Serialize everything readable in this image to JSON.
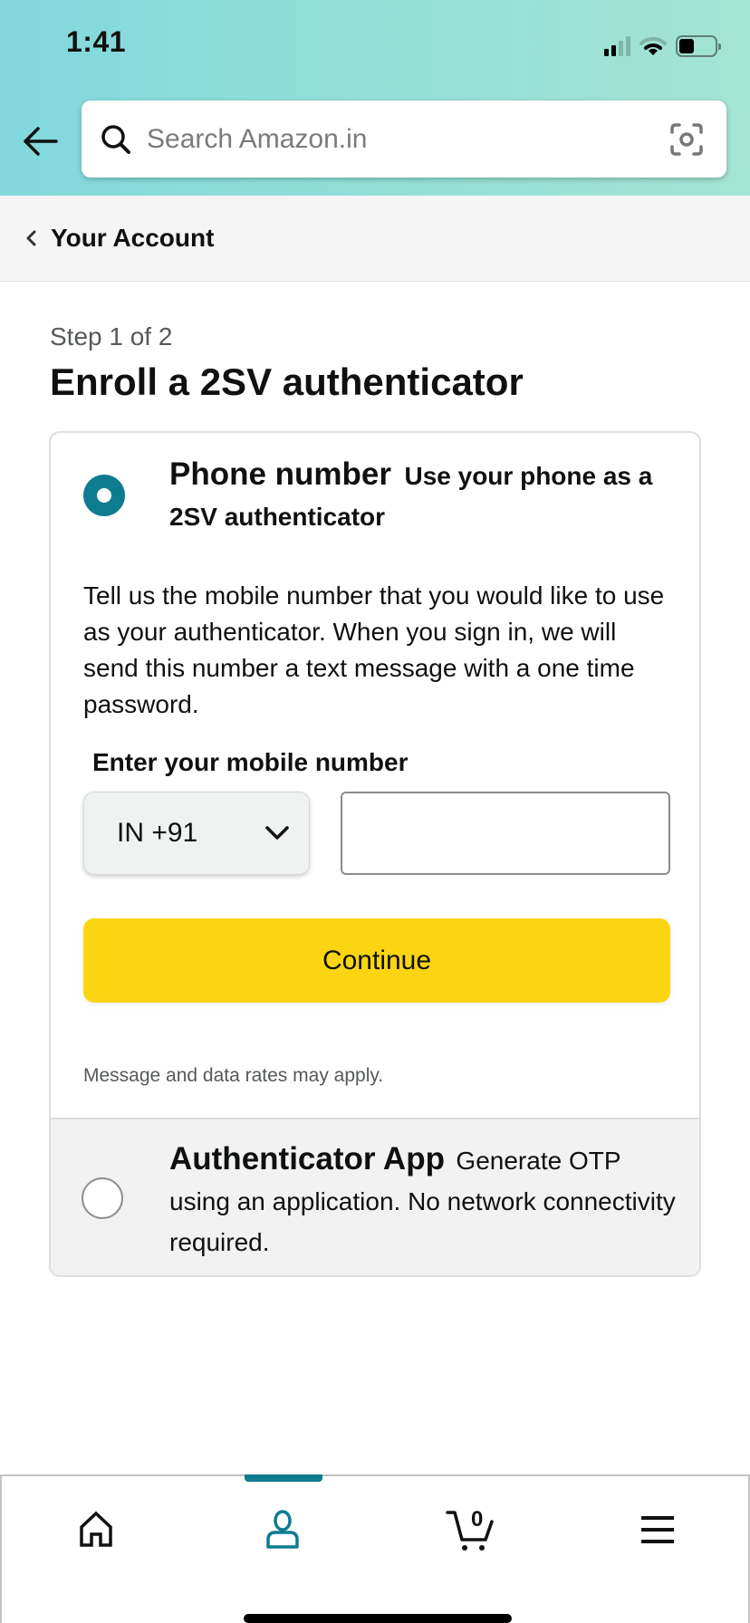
{
  "status_bar": {
    "time": "1:41",
    "signal_icon": "cellular-signal-icon",
    "wifi_icon": "wifi-icon",
    "battery_icon": "battery-icon"
  },
  "header": {
    "back_icon": "arrow-left-icon",
    "search": {
      "placeholder": "Search Amazon.in",
      "value": "",
      "search_icon": "search-icon",
      "camera_icon": "camera-scan-icon"
    }
  },
  "breadcrumb": {
    "label": "Your Account",
    "icon": "chevron-left-icon"
  },
  "main": {
    "step": "Step 1 of 2",
    "title": "Enroll a 2SV authenticator",
    "options": [
      {
        "title": "Phone number",
        "subtitle": "Use your phone as a 2SV authenticator",
        "selected": true,
        "description": "Tell us the mobile number that you would like to use as your authenticator. When you sign in, we will send this number a text message with a one time password.",
        "field_label": "Enter your mobile number",
        "country_code": "IN +91",
        "phone_value": "",
        "continue_label": "Continue",
        "note": "Message and data rates may apply."
      },
      {
        "title": "Authenticator App",
        "subtitle": "Generate OTP using an application. No network connectivity required.",
        "selected": false
      }
    ]
  },
  "bottom_nav": {
    "items": [
      {
        "name": "home",
        "icon": "home-icon",
        "active": false
      },
      {
        "name": "account",
        "icon": "user-icon",
        "active": true
      },
      {
        "name": "cart",
        "icon": "cart-icon",
        "active": false,
        "count": "0"
      },
      {
        "name": "menu",
        "icon": "hamburger-menu-icon",
        "active": false
      }
    ]
  },
  "colors": {
    "accent": "#0e7c8f",
    "button_yellow": "#fcd512",
    "header_gradient_start": "#82d8dd",
    "header_gradient_end": "#a4e4d3"
  }
}
